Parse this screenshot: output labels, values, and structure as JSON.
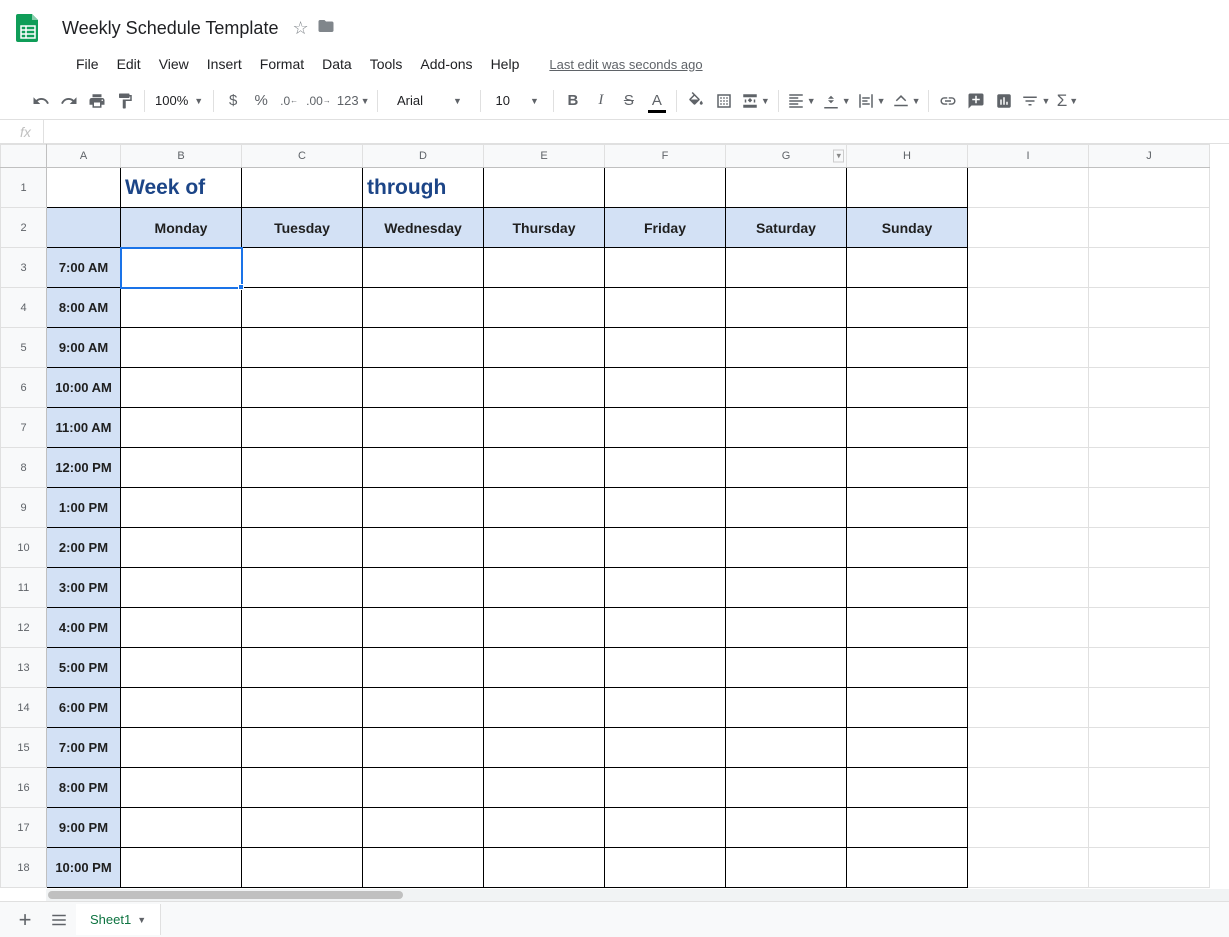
{
  "doc_title": "Weekly Schedule Template",
  "menus": [
    "File",
    "Edit",
    "View",
    "Insert",
    "Format",
    "Data",
    "Tools",
    "Add-ons",
    "Help"
  ],
  "last_edit": "Last edit was seconds ago",
  "toolbar": {
    "zoom": "100%",
    "font": "Arial",
    "font_size": "10",
    "number_format": "123"
  },
  "formula_bar": {
    "fx": "fx",
    "value": ""
  },
  "columns": [
    "A",
    "B",
    "C",
    "D",
    "E",
    "F",
    "G",
    "H",
    "I",
    "J"
  ],
  "row_numbers": [
    1,
    2,
    3,
    4,
    5,
    6,
    7,
    8,
    9,
    10,
    11,
    12,
    13,
    14,
    15,
    16,
    17,
    18
  ],
  "row1": {
    "week_of": "Week of",
    "through": "through"
  },
  "days": [
    "Monday",
    "Tuesday",
    "Wednesday",
    "Thursday",
    "Friday",
    "Saturday",
    "Sunday"
  ],
  "times": [
    "7:00 AM",
    "8:00 AM",
    "9:00 AM",
    "10:00 AM",
    "11:00 AM",
    "12:00 PM",
    "1:00 PM",
    "2:00 PM",
    "3:00 PM",
    "4:00 PM",
    "5:00 PM",
    "6:00 PM",
    "7:00 PM",
    "8:00 PM",
    "9:00 PM",
    "10:00 PM"
  ],
  "sheet_tab": "Sheet1",
  "selected_cell": "B3"
}
